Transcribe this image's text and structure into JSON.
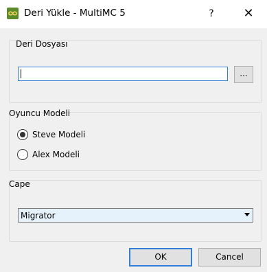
{
  "window": {
    "title": "Deri Yükle - MultiMC 5",
    "help_label": "?",
    "close_label": "✕",
    "app_icon": "multimc-infinity-icon"
  },
  "skin_file_group": {
    "title": "Deri Dosyası",
    "path_value": "",
    "browse_label": "..."
  },
  "player_model_group": {
    "title": "Oyuncu Modeli",
    "options": [
      {
        "label": "Steve Modeli",
        "selected": true
      },
      {
        "label": "Alex Modeli",
        "selected": false
      }
    ]
  },
  "cape_group": {
    "title": "Cape",
    "selected_value": "Migrator"
  },
  "buttons": {
    "ok_label": "OK",
    "cancel_label": "Cancel"
  },
  "colors": {
    "accent": "#2f7ed8",
    "dialog_bg": "#f0f0f0",
    "icon_green": "#5a8a2a"
  }
}
